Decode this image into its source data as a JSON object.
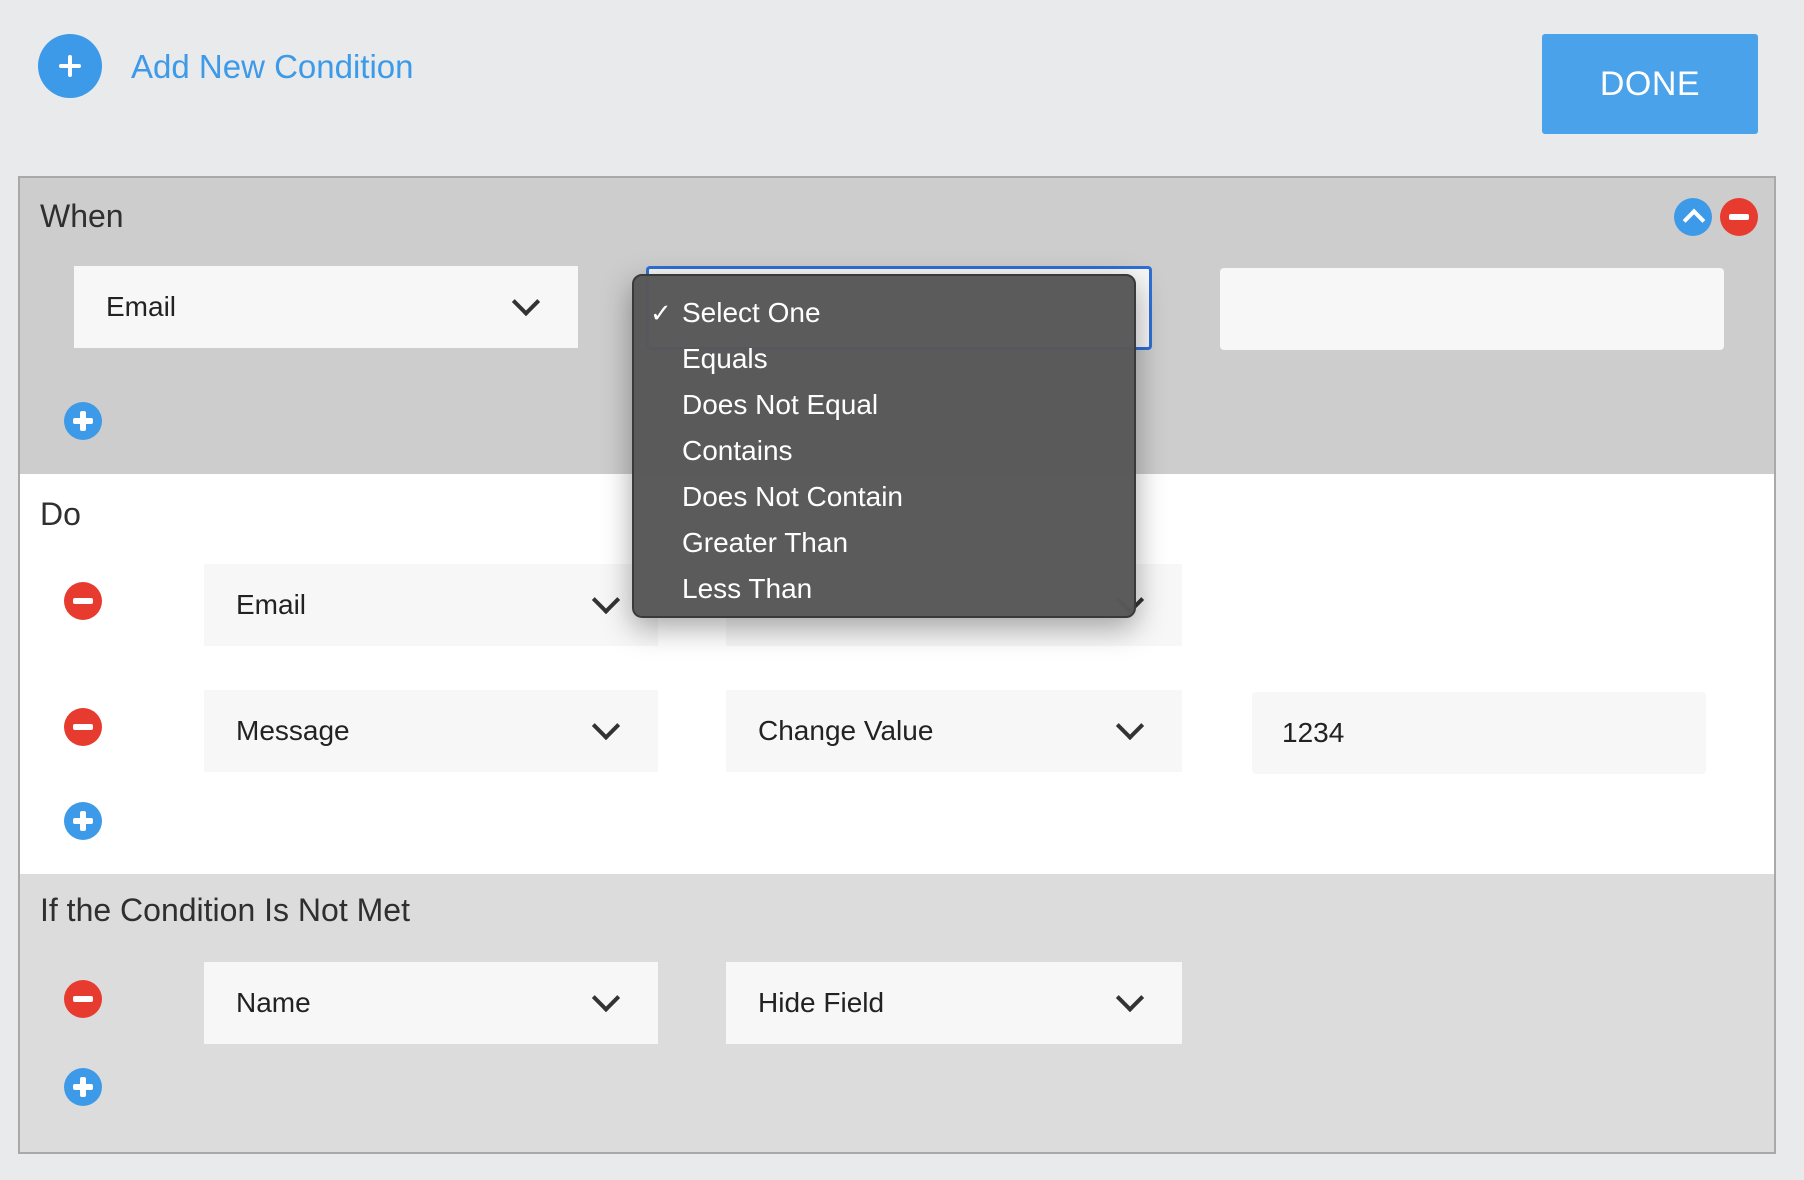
{
  "header": {
    "add_condition_label": "Add New Condition",
    "done_label": "DONE"
  },
  "when": {
    "title": "When",
    "field_value": "Email",
    "operator_value": "Select One",
    "compare_value": ""
  },
  "operator_menu": {
    "selected": "Select One",
    "check_glyph": "✓",
    "options": [
      "Select One",
      "Equals",
      "Does Not Equal",
      "Contains",
      "Does Not Contain",
      "Greater Than",
      "Less Than"
    ]
  },
  "do": {
    "title": "Do",
    "rows": [
      {
        "field": "Email",
        "action": "",
        "value": ""
      },
      {
        "field": "Message",
        "action": "Change Value",
        "value": "1234"
      }
    ]
  },
  "else": {
    "title": "If the Condition Is Not Met",
    "rows": [
      {
        "field": "Name",
        "action": "Hide Field"
      }
    ]
  },
  "colors": {
    "accent": "#3d9ae8",
    "danger": "#e63b2e",
    "menu_bg": "#585858"
  }
}
